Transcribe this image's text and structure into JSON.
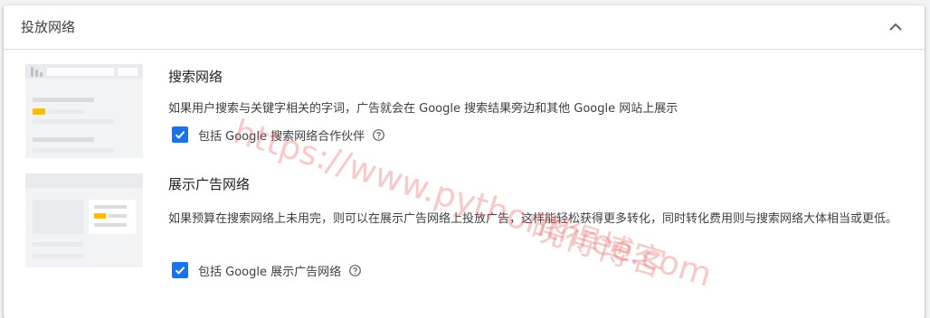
{
  "panel": {
    "title": "投放网络",
    "collapse_icon": "chevron-up-icon"
  },
  "search_network": {
    "title": "搜索网络",
    "description": "如果用户搜索与关键字相关的字词，广告就会在 Google 搜索结果旁边和其他 Google 网站上展示",
    "checkbox": {
      "label": "包括 Google 搜索网络合作伙伴",
      "checked": true
    }
  },
  "display_network": {
    "title": "展示广告网络",
    "description": "如果预算在搜索网络上未用完，则可以在展示广告网络上投放广告，这样能轻松获得更多转化，同时转化费用则与搜索网络大体相当或更低。",
    "checkbox": {
      "label": "包括 Google 展示广告网络",
      "checked": true
    }
  },
  "watermark": {
    "line1": "https://www.pythonthree.com",
    "line2": "晓得博客"
  },
  "colors": {
    "accent": "#1a73e8",
    "highlight": "#fbbc04",
    "illustration_bg": "#f1f3f4",
    "illustration_bar": "#dadce0"
  }
}
